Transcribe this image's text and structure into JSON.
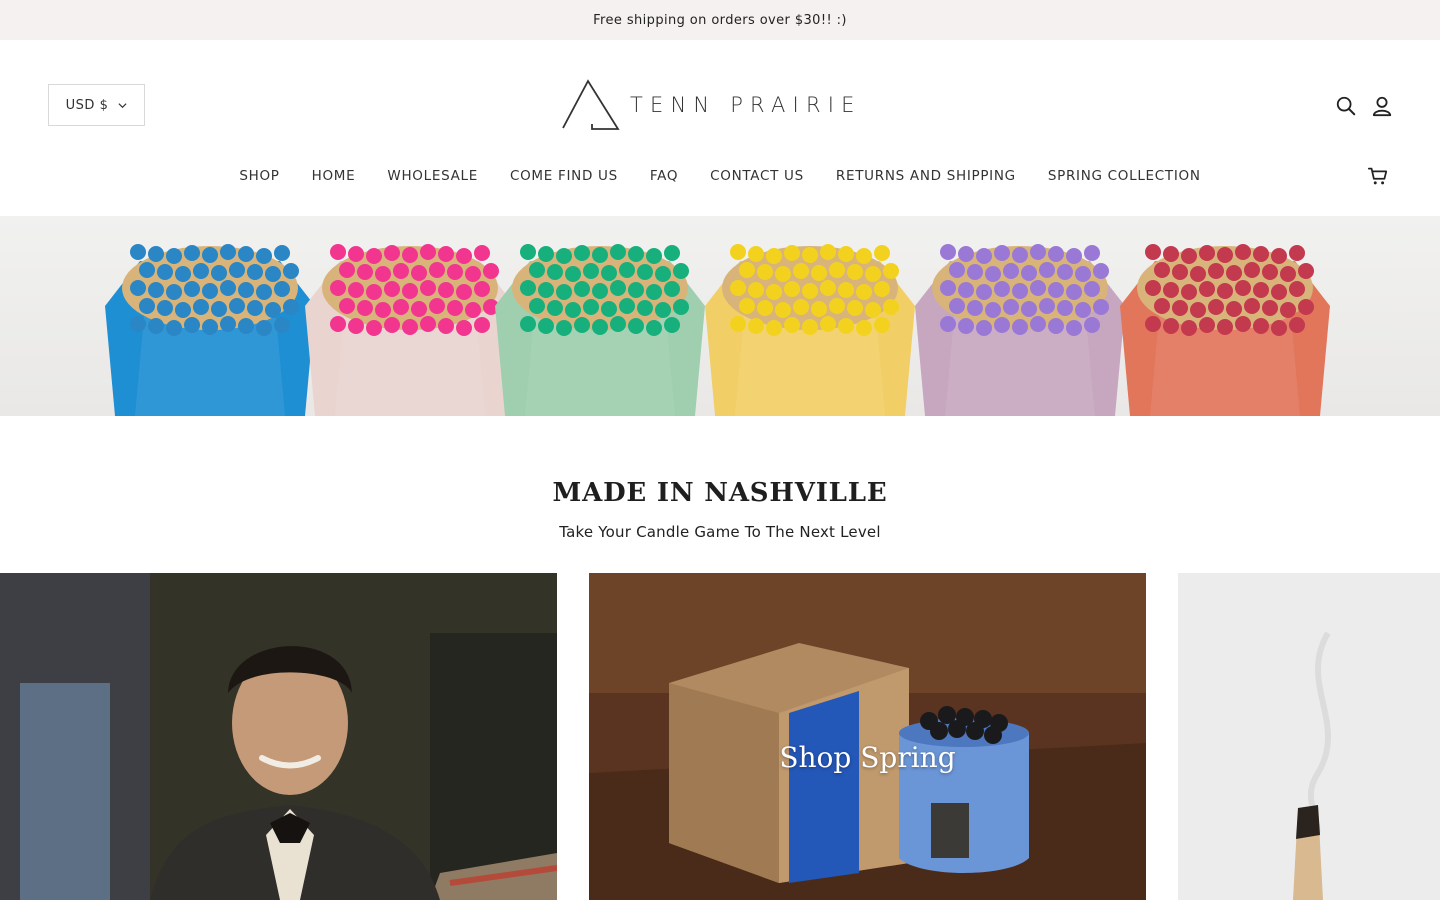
{
  "announcement": {
    "text": "Free shipping on orders over $30!! :)"
  },
  "header": {
    "currency_label": "USD $",
    "logo_text": "TENN PRAIRIE",
    "icons": [
      "search-icon",
      "account-icon",
      "cart-icon"
    ]
  },
  "nav": {
    "items": [
      {
        "label": "SHOP"
      },
      {
        "label": "HOME"
      },
      {
        "label": "WHOLESALE"
      },
      {
        "label": "COME FIND US"
      },
      {
        "label": "FAQ"
      },
      {
        "label": "CONTACT US"
      },
      {
        "label": "RETURNS AND SHIPPING"
      },
      {
        "label": "SPRING COLLECTION"
      }
    ]
  },
  "hero": {
    "holder_colors": [
      "#1f8fd3",
      "#e9d4d0",
      "#9fcfae",
      "#f2cf66",
      "#c7a6bf",
      "#e2765b"
    ],
    "match_colors": [
      "#2a86c4",
      "#f2368f",
      "#17b07d",
      "#f3d21f",
      "#9a79d6",
      "#c3394e"
    ]
  },
  "section": {
    "title": "MADE IN NASHVILLE",
    "subtitle": "Take Your Candle Game To The Next Level"
  },
  "cards": [
    {
      "label": ""
    },
    {
      "label": "Shop Spring"
    },
    {
      "label": ""
    }
  ]
}
